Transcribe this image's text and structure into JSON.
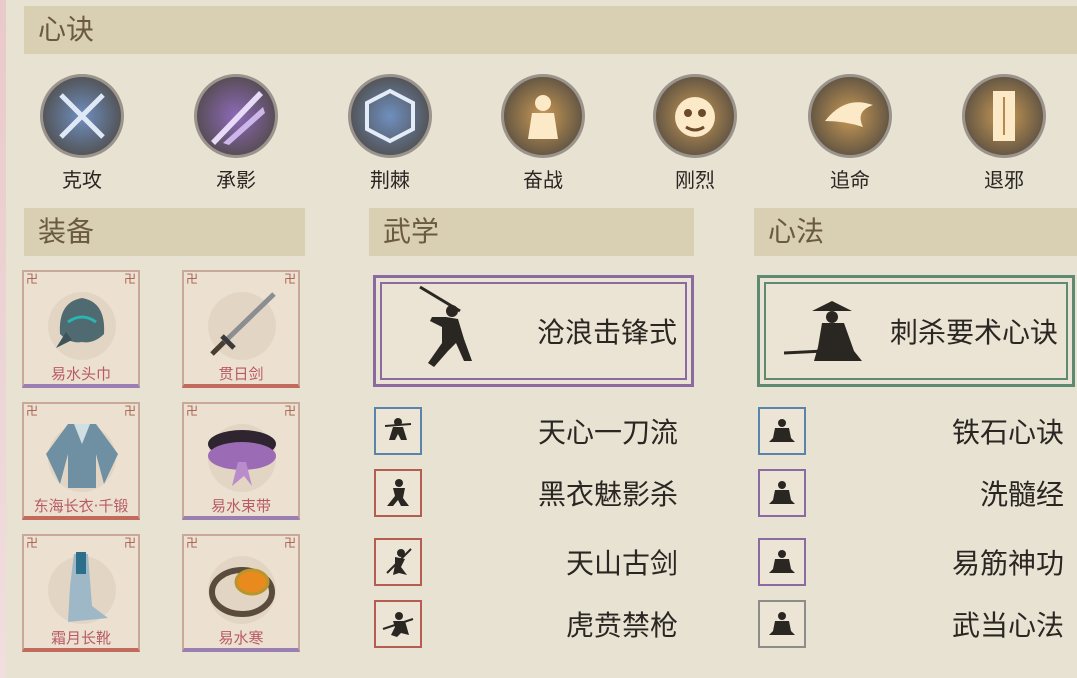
{
  "sections": {
    "heart_formula": "心诀",
    "equipment": "装备",
    "martial_arts": "武学",
    "mind_method": "心法"
  },
  "skills": [
    {
      "name": "克攻",
      "color": "#6f8fbf",
      "icon": "crossed-blades-icon"
    },
    {
      "name": "承影",
      "color": "#8c6ab8",
      "icon": "light-rays-icon"
    },
    {
      "name": "荆棘",
      "color": "#6f8fbf",
      "icon": "thorn-shield-icon"
    },
    {
      "name": "奋战",
      "color": "#c99a55",
      "icon": "warrior-icon"
    },
    {
      "name": "刚烈",
      "color": "#c99a55",
      "icon": "beast-face-icon"
    },
    {
      "name": "追命",
      "color": "#c99a55",
      "icon": "dash-swirl-icon"
    },
    {
      "name": "退邪",
      "color": "#c99a55",
      "icon": "talisman-icon"
    }
  ],
  "equipment": [
    {
      "label": "易水头巾",
      "rarity": "purple",
      "icon": "hood-icon"
    },
    {
      "label": "贯日剑",
      "rarity": "red",
      "icon": "sword-icon"
    },
    {
      "label": "东海长衣·千锻",
      "rarity": "red",
      "icon": "robe-icon"
    },
    {
      "label": "易水束带",
      "rarity": "purple",
      "icon": "belt-icon"
    },
    {
      "label": "霜月长靴",
      "rarity": "red",
      "icon": "boots-icon"
    },
    {
      "label": "易水寒",
      "rarity": "purple",
      "icon": "ring-icon"
    }
  ],
  "martial": {
    "featured": {
      "title": "沧浪击锋式",
      "rarity": "purple",
      "icon": "swordsman-icon"
    },
    "list": [
      {
        "title": "天心一刀流",
        "rarity": "blue",
        "icon": "swordsman-icon"
      },
      {
        "title": "黑衣魅影杀",
        "rarity": "red",
        "icon": "shadow-assassin-icon"
      },
      {
        "title": "天山古剑",
        "rarity": "red",
        "icon": "leaping-swordsman-icon"
      },
      {
        "title": "虎贲禁枪",
        "rarity": "red",
        "icon": "spearman-icon"
      }
    ]
  },
  "mind": {
    "featured": {
      "title": "刺杀要术心诀",
      "rarity": "green",
      "icon": "crouching-assassin-icon"
    },
    "list": [
      {
        "title": "铁石心诀",
        "rarity": "blue",
        "icon": "meditating-monk-icon"
      },
      {
        "title": "洗髓经",
        "rarity": "purple",
        "icon": "meditating-monk-icon"
      },
      {
        "title": "易筋神功",
        "rarity": "purple",
        "icon": "meditating-monk-icon"
      },
      {
        "title": "武当心法",
        "rarity": "gray",
        "icon": "meditating-monk-icon"
      }
    ]
  }
}
